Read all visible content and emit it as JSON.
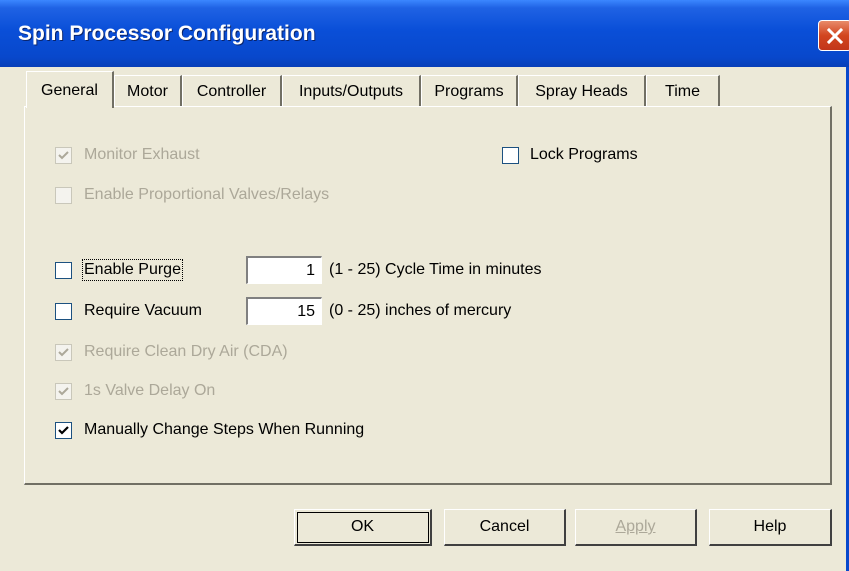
{
  "window": {
    "title": "Spin Processor Configuration",
    "close_icon": "close-icon"
  },
  "tabs": [
    {
      "label": "General",
      "active": true
    },
    {
      "label": "Motor",
      "active": false
    },
    {
      "label": "Controller",
      "active": false
    },
    {
      "label": "Inputs/Outputs",
      "active": false
    },
    {
      "label": "Programs",
      "active": false
    },
    {
      "label": "Spray Heads",
      "active": false
    },
    {
      "label": "Time",
      "active": false
    }
  ],
  "general": {
    "monitor_exhaust": {
      "label": "Monitor Exhaust",
      "checked": true,
      "enabled": false
    },
    "lock_programs": {
      "label": "Lock Programs",
      "checked": false,
      "enabled": true
    },
    "enable_proportional": {
      "label": "Enable Proportional Valves/Relays",
      "checked": false,
      "enabled": false
    },
    "enable_purge": {
      "label": "Enable Purge",
      "checked": false,
      "enabled": true,
      "value": "1",
      "range_text": "(1 - 25) Cycle Time in minutes"
    },
    "require_vacuum": {
      "label": "Require Vacuum",
      "checked": false,
      "enabled": true,
      "value": "15",
      "range_text": "(0 - 25) inches of mercury"
    },
    "require_cda": {
      "label": "Require Clean Dry Air (CDA)",
      "checked": true,
      "enabled": false
    },
    "valve_delay": {
      "label": "1s Valve Delay On",
      "checked": true,
      "enabled": false
    },
    "manual_steps": {
      "label": "Manually Change Steps When Running",
      "checked": true,
      "enabled": true
    }
  },
  "buttons": {
    "ok": "OK",
    "cancel": "Cancel",
    "apply": "Apply",
    "help": "Help"
  },
  "colors": {
    "title_bar": "#0a4fd8",
    "dialog_bg": "#ece9d8",
    "disabled_text": "#aca899",
    "close_button": "#d2451f"
  }
}
